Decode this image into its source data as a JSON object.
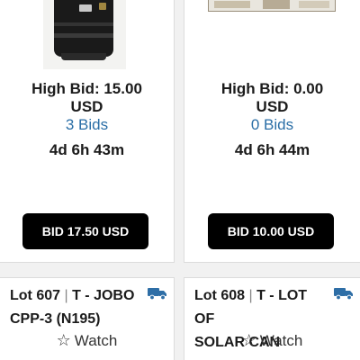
{
  "lots": [
    {
      "high_bid_line1": "High Bid: 15.00",
      "high_bid_line2": "USD",
      "bids": "3 Bids",
      "time_left": "4d 6h 43m",
      "bid_button": "BID 17.50 USD"
    },
    {
      "high_bid_line1": "High Bid: 0.00",
      "high_bid_line2": "USD",
      "bids": "0 Bids",
      "time_left": "4d 6h 44m",
      "bid_button": "BID 10.00 USD"
    },
    {
      "lot_number": "Lot 607",
      "separator": "|",
      "title_line1": "T - JOBO",
      "title_line2": "CPP-3 (N195)",
      "watch": "Watch"
    },
    {
      "lot_number": "Lot 608",
      "separator": "|",
      "title_line1": "T - LOT OF",
      "title_line2": "SOLAR CAN KITS…",
      "watch": "Watch"
    }
  ],
  "colors": {
    "link": "#2a6ea6",
    "button_bg": "#000000",
    "shipping_icon": "#2e6ea6"
  },
  "icons": {
    "shipping": "truck-icon",
    "watch": "star-outline-icon"
  }
}
